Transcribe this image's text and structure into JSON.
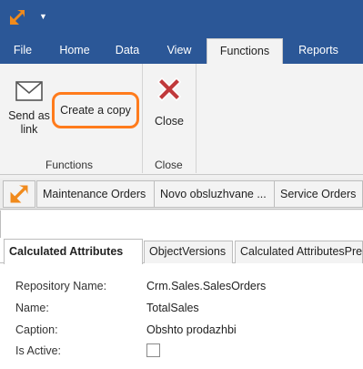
{
  "ribbon_tabs": [
    "File",
    "Home",
    "Data",
    "View",
    "Functions",
    "Reports"
  ],
  "active_tab": "Functions",
  "ribbon": {
    "send_as_link": "Send as link",
    "send_as_link_line1": "Send as",
    "send_as_link_line2": "link",
    "create_copy": "Create a copy",
    "close": "Close",
    "group_functions": "Functions",
    "group_close": "Close"
  },
  "document_tabs": [
    "Maintenance Orders",
    "Novo obsluzhvane ...",
    "Service Orders"
  ],
  "sub_tabs": [
    "Calculated Attributes",
    "ObjectVersions",
    "Calculated AttributesPre"
  ],
  "fields": {
    "repository_name_label": "Repository Name:",
    "repository_name_value": "Crm.Sales.SalesOrders",
    "name_label": "Name:",
    "name_value": "TotalSales",
    "caption_label": "Caption:",
    "caption_value": "Obshto prodazhbi",
    "is_active_label": "Is Active:"
  },
  "colors": {
    "ribbon_blue": "#2b5797",
    "highlight_orange": "#ff7b1c",
    "logo_orange": "#f08a1c",
    "close_red": "#c0393b"
  }
}
